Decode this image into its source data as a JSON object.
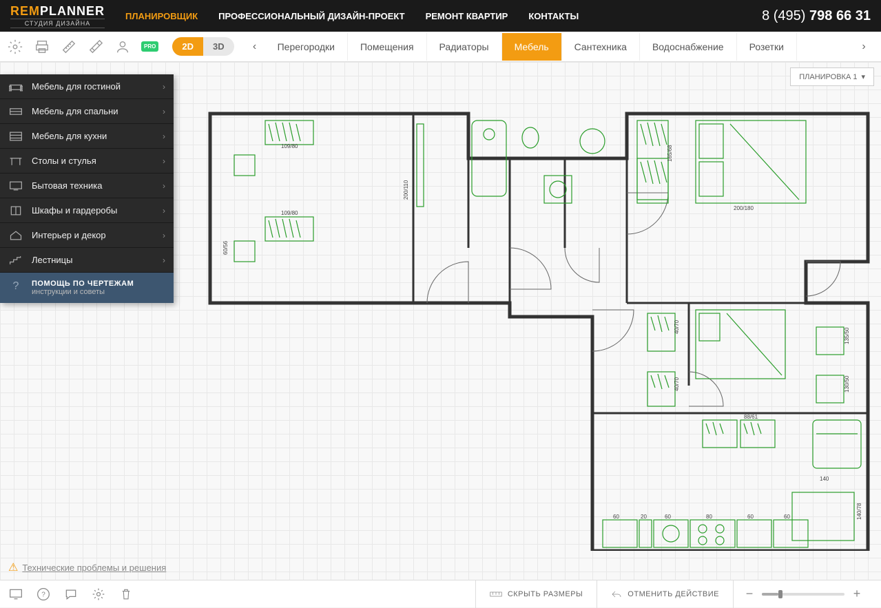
{
  "header": {
    "logo_rem": "REM",
    "logo_planner": "PLANNER",
    "logo_sub": "СТУДИЯ ДИЗАЙНА",
    "nav": [
      {
        "label": "ПЛАНИРОВЩИК",
        "active": true
      },
      {
        "label": "ПРОФЕССИОНАЛЬНЫЙ ДИЗАЙН-ПРОЕКТ",
        "active": false
      },
      {
        "label": "РЕМОНТ КВАРТИР",
        "active": false
      },
      {
        "label": "КОНТАКТЫ",
        "active": false
      }
    ],
    "phone_prefix": "8 (495) ",
    "phone_number": "798 66 31"
  },
  "toolbar": {
    "pro_label": "PRO",
    "view_2d": "2D",
    "view_3d": "3D",
    "tabs": [
      {
        "label": "Перегородки",
        "active": false
      },
      {
        "label": "Помещения",
        "active": false
      },
      {
        "label": "Радиаторы",
        "active": false
      },
      {
        "label": "Мебель",
        "active": true
      },
      {
        "label": "Сантехника",
        "active": false
      },
      {
        "label": "Водоснабжение",
        "active": false
      },
      {
        "label": "Розетки",
        "active": false
      }
    ]
  },
  "plan_dropdown": "ПЛАНИРОВКА 1",
  "sidebar": {
    "items": [
      {
        "label": "Мебель для гостиной",
        "icon": "sofa"
      },
      {
        "label": "Мебель для спальни",
        "icon": "bed"
      },
      {
        "label": "Мебель для кухни",
        "icon": "kitchen"
      },
      {
        "label": "Столы и стулья",
        "icon": "table"
      },
      {
        "label": "Бытовая техника",
        "icon": "screen"
      },
      {
        "label": "Шкафы и гардеробы",
        "icon": "wardrobe"
      },
      {
        "label": "Интерьер и декор",
        "icon": "house"
      },
      {
        "label": "Лестницы",
        "icon": "stairs"
      }
    ],
    "help_title": "ПОМОЩЬ ПО ЧЕРТЕЖАМ",
    "help_sub": "инструкции и советы"
  },
  "tech_link": "Технические проблемы и решения",
  "footer": {
    "hide_sizes": "СКРЫТЬ РАЗМЕРЫ",
    "undo": "ОТМЕНИТЬ ДЕЙСТВИЕ"
  },
  "floorplan_dims": {
    "left_room_width1": "109/80",
    "left_room_width2": "109/80",
    "left_room_height": "200/110",
    "left_chair": "60/56",
    "bed1_w": "200/180",
    "wardrobe1": "165/68",
    "wardrobe2": "40/70",
    "bed2_side": "130/50",
    "bed2_side2": "135/50",
    "small_w": "40/70",
    "kitchen_top": "88/61",
    "table_w": "140",
    "kitchen_units": [
      "60",
      "20",
      "60",
      "80",
      "60",
      "60"
    ],
    "side_counter": "140/78"
  }
}
